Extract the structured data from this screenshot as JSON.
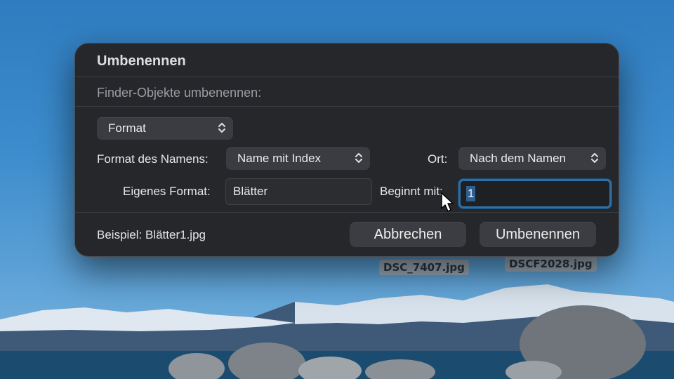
{
  "desktop": {
    "files": [
      {
        "name": "DSC_7407.jpg"
      },
      {
        "name": "DSCF2028.jpg"
      }
    ]
  },
  "dialog": {
    "title": "Umbenennen",
    "subtitle": "Finder-Objekte umbenennen:",
    "mode_popup": {
      "value": "Format"
    },
    "name_format": {
      "label": "Format des Namens:",
      "value": "Name mit Index"
    },
    "location": {
      "label": "Ort:",
      "value": "Nach dem Namen"
    },
    "custom_format": {
      "label": "Eigenes Format:",
      "value": "Blätter"
    },
    "start_at": {
      "label": "Beginnt mit:",
      "value": "1"
    },
    "example": "Beispiel: Blätter1.jpg",
    "buttons": {
      "cancel": "Abbrechen",
      "rename": "Umbenennen"
    }
  },
  "colors": {
    "dialog_bg": "#25272b",
    "accent_focus": "#2f6fa4",
    "button_bg": "#3b3d42"
  }
}
